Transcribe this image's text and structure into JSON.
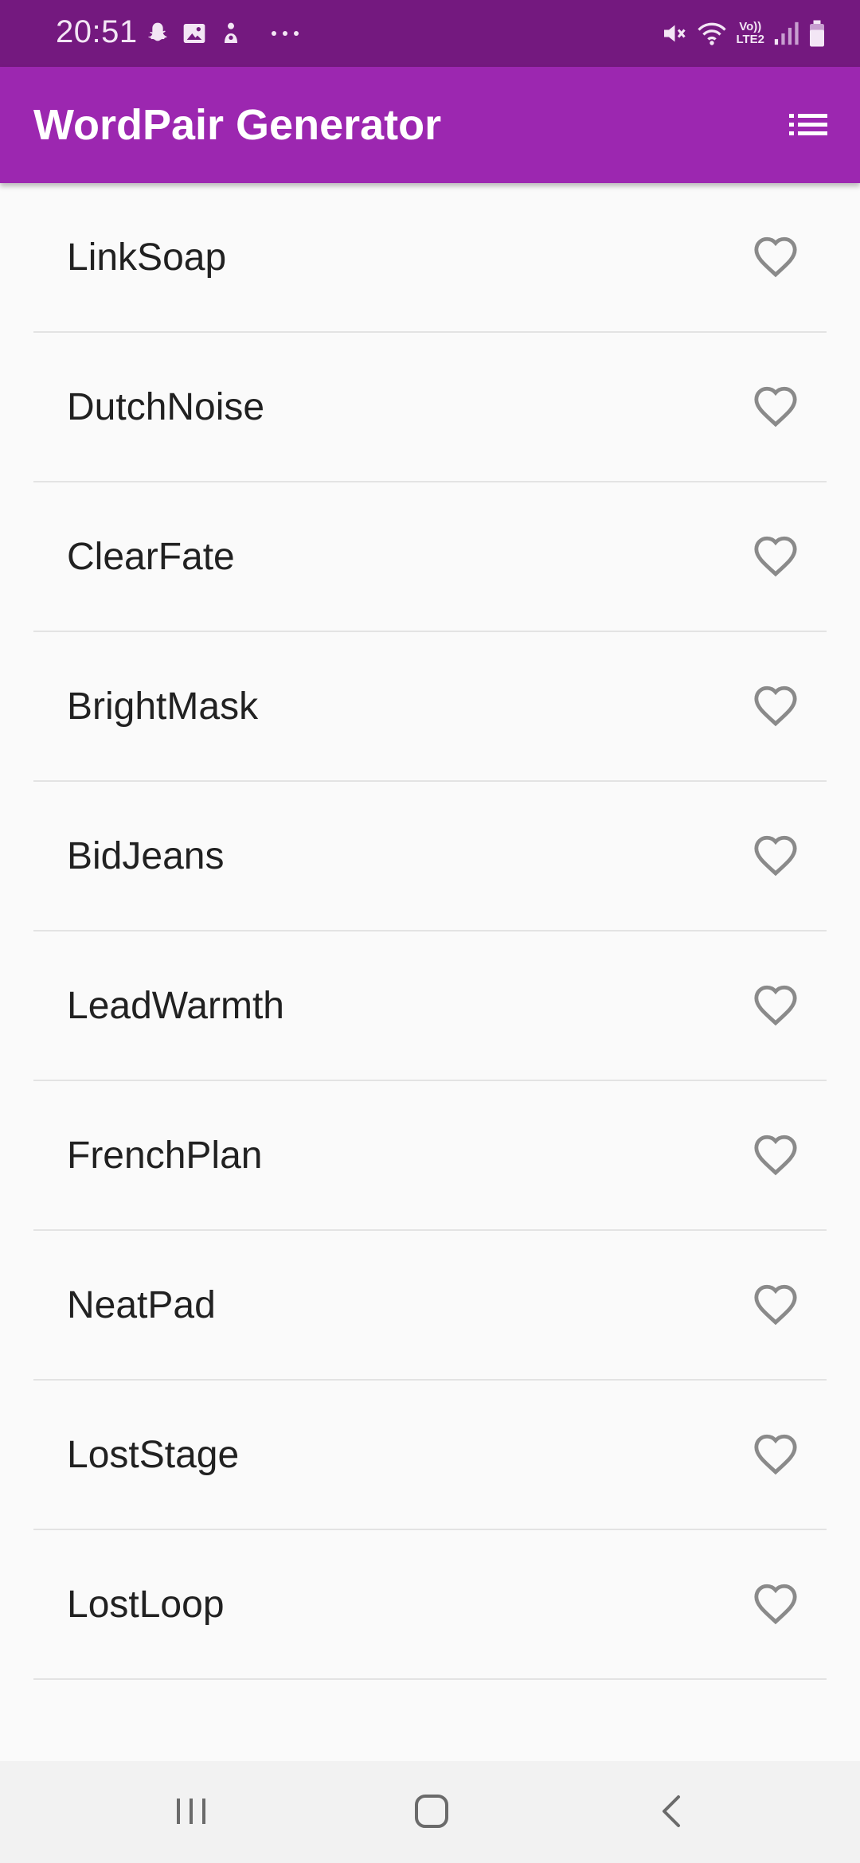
{
  "status_bar": {
    "time": "20:51",
    "left_icons": [
      "snapchat-icon",
      "gallery-icon",
      "notification-icon",
      "more-dots-icon"
    ],
    "right_icons": [
      "mute-icon",
      "wifi-icon",
      "volte-icon",
      "signal-icon",
      "battery-icon"
    ],
    "volte_line1": "Vo))",
    "volte_line2": "LTE2"
  },
  "app_bar": {
    "title": "WordPair Generator",
    "action_icon": "list-icon",
    "background": "#9c27b0"
  },
  "word_list": {
    "items": [
      {
        "label": "LinkSoap",
        "favorited": false
      },
      {
        "label": "DutchNoise",
        "favorited": false
      },
      {
        "label": "ClearFate",
        "favorited": false
      },
      {
        "label": "BrightMask",
        "favorited": false
      },
      {
        "label": "BidJeans",
        "favorited": false
      },
      {
        "label": "LeadWarmth",
        "favorited": false
      },
      {
        "label": "FrenchPlan",
        "favorited": false
      },
      {
        "label": "NeatPad",
        "favorited": false
      },
      {
        "label": "LostStage",
        "favorited": false
      },
      {
        "label": "LostLoop",
        "favorited": false
      }
    ],
    "heart_icon": "heart-outline-icon",
    "heart_color": "#8a8a8a"
  },
  "nav_bar": {
    "buttons": [
      "recents-icon",
      "home-icon",
      "back-icon"
    ]
  }
}
